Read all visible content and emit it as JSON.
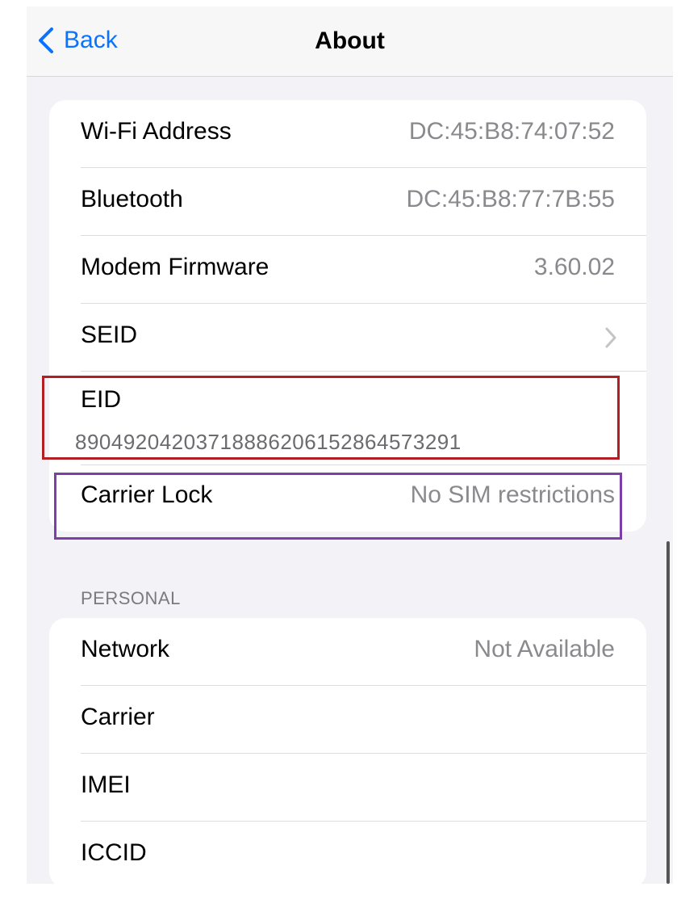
{
  "nav": {
    "back_label": "Back",
    "title": "About"
  },
  "network_info": [
    {
      "label": "Wi-Fi Address",
      "value": "DC:45:B8:74:07:52"
    },
    {
      "label": "Bluetooth",
      "value": "DC:45:B8:77:7B:55"
    },
    {
      "label": "Modem Firmware",
      "value": "3.60.02"
    },
    {
      "label": "SEID"
    }
  ],
  "eid": {
    "label": "EID",
    "value": "89049204203718886206152864573291"
  },
  "carrier_lock": {
    "label": "Carrier Lock",
    "value": "No SIM restrictions"
  },
  "personal": {
    "header": "PERSONAL",
    "rows": [
      {
        "label": "Network",
        "value": "Not Available"
      },
      {
        "label": "Carrier"
      },
      {
        "label": "IMEI"
      },
      {
        "label": "ICCID"
      }
    ]
  },
  "annotations": {
    "eid_box_color": "#b21f24",
    "carrier_lock_box_color": "#7b3fa7"
  },
  "accent_color": "#0a72ff"
}
